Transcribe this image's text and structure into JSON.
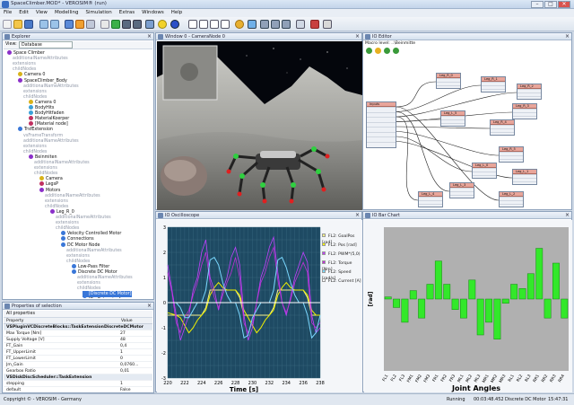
{
  "window": {
    "title": "SpaceClimber.MOD* - VEROSIM® (run)"
  },
  "menu": [
    "File",
    "Edit",
    "View",
    "Modelling",
    "Simulation",
    "Extras",
    "Windows",
    "Help"
  ],
  "explorer": {
    "title": "Explorer",
    "view_label": "View:",
    "view_value": "Database",
    "tree": [
      {
        "label": "Space Climber",
        "indent": 0,
        "color": "#8b2fc9"
      },
      {
        "label": "additionalNameAttributes",
        "indent": 1,
        "color": "",
        "faded": true
      },
      {
        "label": "extensions",
        "indent": 1,
        "color": "",
        "faded": true
      },
      {
        "label": "childNodes",
        "indent": 1,
        "color": "",
        "faded": true
      },
      {
        "label": "Camera 0",
        "indent": 2,
        "color": "#d8b21a"
      },
      {
        "label": "SpaceClimber_Body",
        "indent": 2,
        "color": "#8b2fc9"
      },
      {
        "label": "additionalNameAttributes",
        "indent": 3,
        "color": "",
        "faded": true
      },
      {
        "label": "extensions",
        "indent": 3,
        "color": "",
        "faded": true
      },
      {
        "label": "childNodes",
        "indent": 3,
        "color": "",
        "faded": true
      },
      {
        "label": "Camera 0",
        "indent": 4,
        "color": "#d8b21a"
      },
      {
        "label": "BodyHits",
        "indent": 4,
        "color": "#3aa0d8"
      },
      {
        "label": "BodyHitfaden",
        "indent": 4,
        "color": "#3aa0d8"
      },
      {
        "label": "MaterialKoerper",
        "indent": 4,
        "color": "#c03060"
      },
      {
        "label": "[Material node]",
        "indent": 4,
        "color": "#c03060"
      },
      {
        "label": "TrsfExtension",
        "indent": 2,
        "color": "#3a77d8"
      },
      {
        "label": "vsFrameTransform",
        "indent": 3,
        "color": "",
        "faded": true
      },
      {
        "label": "additionalNameAttributes",
        "indent": 3,
        "color": "",
        "faded": true
      },
      {
        "label": "extensions",
        "indent": 3,
        "color": "",
        "faded": true
      },
      {
        "label": "childNodes",
        "indent": 3,
        "color": "",
        "faded": true
      },
      {
        "label": "Beinmiten",
        "indent": 4,
        "color": "#8b2fc9"
      },
      {
        "label": "additionalNameAttributes",
        "indent": 5,
        "color": "",
        "faded": true
      },
      {
        "label": "extensions",
        "indent": 5,
        "color": "",
        "faded": true
      },
      {
        "label": "childNodes",
        "indent": 5,
        "color": "",
        "faded": true
      },
      {
        "label": "Camera",
        "indent": 6,
        "color": "#d8b21a"
      },
      {
        "label": "LegsP",
        "indent": 6,
        "color": "#c03060"
      },
      {
        "label": "Motors",
        "indent": 6,
        "color": "#8b2fc9"
      },
      {
        "label": "additionalNameAttributes",
        "indent": 7,
        "color": "",
        "faded": true
      },
      {
        "label": "extensions",
        "indent": 7,
        "color": "",
        "faded": true
      },
      {
        "label": "childNodes",
        "indent": 7,
        "color": "",
        "faded": true
      },
      {
        "label": "Leg_R_0",
        "indent": 8,
        "color": "#8b2fc9"
      },
      {
        "label": "additionalNameAttributes",
        "indent": 9,
        "color": "",
        "faded": true
      },
      {
        "label": "extensions",
        "indent": 9,
        "color": "",
        "faded": true
      },
      {
        "label": "childNodes",
        "indent": 9,
        "color": "",
        "faded": true
      },
      {
        "label": "Velocity Controlled Motor",
        "indent": 10,
        "color": "#3a77d8"
      },
      {
        "label": "Connections",
        "indent": 10,
        "color": "#3a77d8"
      },
      {
        "label": "DC Motor Node",
        "indent": 10,
        "color": "#3a77d8"
      },
      {
        "label": "additionalNameAttributes",
        "indent": 11,
        "color": "",
        "faded": true
      },
      {
        "label": "extensions",
        "indent": 11,
        "color": "",
        "faded": true
      },
      {
        "label": "childNodes",
        "indent": 11,
        "color": "",
        "faded": true
      },
      {
        "label": "Low-Pass Filter",
        "indent": 12,
        "color": "#3a77d8"
      },
      {
        "label": "Discrete DC Motor",
        "indent": 12,
        "color": "#3a77d8"
      },
      {
        "label": "additionalNameAttributes",
        "indent": 13,
        "color": "",
        "faded": true
      },
      {
        "label": "extensions",
        "indent": 13,
        "color": "",
        "faded": true
      },
      {
        "label": "childNodes",
        "indent": 13,
        "color": "",
        "faded": true
      },
      {
        "label": "[Discrete DC Motor]",
        "indent": 14,
        "color": "#3a77d8",
        "selected": true
      },
      {
        "label": "[PosExtension]",
        "indent": 14,
        "color": "#3a77d8"
      }
    ]
  },
  "properties": {
    "title": "Properties of selection",
    "filter": "All properties",
    "col_property": "Property",
    "col_value": "Value",
    "rows": [
      {
        "k": "VSPluginVCDiscreteBlocks::TaskExtensionDiscreteDCMotor",
        "v": "",
        "section": true
      },
      {
        "k": "Max Torque [Nm]",
        "v": "27"
      },
      {
        "k": "Supply Voltage [V]",
        "v": "48"
      },
      {
        "k": "FT_Gain",
        "v": "0,4"
      },
      {
        "k": "FT_UpperLimit",
        "v": "1"
      },
      {
        "k": "FT_LowerLimit",
        "v": "0"
      },
      {
        "k": "Jm_Gain",
        "v": "0,0760..."
      },
      {
        "k": "Gearbox Ratio",
        "v": "0,01"
      },
      {
        "k": "VSDiskDiscScheduler::TaskExtension",
        "v": "",
        "section": true
      },
      {
        "k": "stepping",
        "v": "1"
      },
      {
        "k": "default",
        "v": "False"
      }
    ]
  },
  "viewport": {
    "title": "Window 0 - CameraNode 0"
  },
  "ioeditor": {
    "title": "IO Editor",
    "macro_level": "Macro level: ..\\Beinmitte",
    "nodes": [
      "Leg_R_0",
      "Leg_R_1",
      "Leg_R_2",
      "Leg_R_3",
      "Leg_R_4",
      "Leg_R_5",
      "Leg_L_0",
      "Leg_L_1",
      "Leg_L_2",
      "Leg_L_3",
      "Leg_L_4",
      "Leg_L_5",
      "Inputs"
    ]
  },
  "oscope": {
    "title": "IO Oscilloscope",
    "legend": [
      {
        "label": "FL2: GoalPos [rad]",
        "color": "#f5f08a"
      },
      {
        "label": "FL2: Pos [rad]",
        "color": "#f2f200"
      },
      {
        "label": "FL2: PWM*(5,0)",
        "color": "#c040ff"
      },
      {
        "label": "FL2: Torque [Nm]",
        "color": "#c02fd8"
      },
      {
        "label": "FL2: Speed [rad/s]",
        "color": "#7ad8ff"
      },
      {
        "label": "FL2: Current [A]",
        "color": "#ffffff"
      }
    ],
    "xlabel": "Time [s]",
    "xticks": [
      "220",
      "222",
      "224",
      "226",
      "228",
      "230",
      "232",
      "234",
      "236",
      "238"
    ],
    "yticks": [
      "3",
      "2",
      "1",
      "0",
      "-1",
      "-2",
      "-3"
    ]
  },
  "barchart": {
    "title": "IO Bar Chart",
    "ylabel": "[rad]",
    "xlabel": "Joint Angles",
    "ticklabels": [
      "FL1",
      "FL2",
      "FL3",
      "FM1",
      "FM2",
      "FM3",
      "FR1",
      "FR2",
      "FR3",
      "ML1",
      "ML2",
      "ML3",
      "MR1",
      "MR2",
      "MR3",
      "RL1",
      "RL2",
      "RL3",
      "RR1",
      "RR2",
      "RR3",
      "RR4"
    ]
  },
  "status": {
    "copyright": "Copyright © - VEROSIM - Germany",
    "state": "Running",
    "time": "00:03:48.452",
    "selection": "Discrete DC Motor",
    "clock": "15:47:31"
  },
  "chart_data": [
    {
      "type": "line",
      "title": "",
      "xlabel": "Time [s]",
      "ylabel": "",
      "xlim": [
        220,
        238
      ],
      "ylim": [
        -3,
        3
      ],
      "grid": true,
      "legend": "right",
      "x": [
        220,
        220.5,
        221,
        221.5,
        222,
        222.5,
        223,
        223.5,
        224,
        224.5,
        225,
        225.5,
        226,
        226.5,
        227,
        227.5,
        228,
        228.5,
        229,
        229.5,
        230,
        230.5,
        231,
        231.5,
        232,
        232.5,
        233,
        233.5,
        234,
        234.5,
        235,
        235.5,
        236,
        236.5,
        237,
        237.5,
        238
      ],
      "series": [
        {
          "name": "FL2: GoalPos [rad]",
          "values": [
            -0.5,
            -0.5,
            -0.5,
            -0.5,
            -0.5,
            -0.5,
            -0.5,
            -0.5,
            -0.5,
            -0.2,
            0.5,
            0.5,
            0.5,
            0.5,
            0.5,
            0.5,
            0.5,
            0.2,
            -0.5,
            -0.5,
            -0.5,
            -0.5,
            -0.5,
            -0.5,
            -0.5,
            -0.2,
            0.5,
            0.5,
            0.5,
            0.5,
            0.5,
            0.5,
            0.5,
            0.2,
            -0.5,
            -0.5,
            -0.5
          ]
        },
        {
          "name": "FL2: Pos [rad]",
          "values": [
            -0.4,
            -0.45,
            -0.5,
            -0.6,
            -0.9,
            -1.2,
            -1.0,
            -0.7,
            -0.5,
            -0.3,
            0.3,
            0.6,
            0.8,
            0.6,
            0.5,
            0.5,
            0.5,
            0.3,
            -0.3,
            -0.6,
            -0.9,
            -1.2,
            -1.0,
            -0.7,
            -0.5,
            -0.3,
            0.3,
            0.6,
            0.8,
            0.6,
            0.5,
            0.5,
            0.5,
            0.3,
            -0.3,
            -0.5,
            -0.5
          ]
        },
        {
          "name": "FL2: PWM*(5,0)",
          "values": [
            1.5,
            0.5,
            -0.5,
            -1.5,
            -1.0,
            -0.5,
            0.5,
            1.0,
            2.0,
            2.5,
            1.0,
            0.5,
            -0.3,
            0.5,
            1.0,
            1.8,
            2.2,
            1.5,
            -0.5,
            -1.5,
            -1.0,
            0.0,
            1.0,
            1.5,
            2.2,
            2.6,
            1.2,
            0.0,
            -0.5,
            0.2,
            1.0,
            1.5,
            2.0,
            1.6,
            -0.5,
            -1.2,
            -1.0
          ]
        },
        {
          "name": "FL2: Torque [Nm]",
          "values": [
            1.2,
            0.4,
            -0.8,
            -1.2,
            -0.6,
            -0.3,
            0.3,
            0.8,
            1.5,
            2.0,
            0.8,
            0.2,
            -0.2,
            0.3,
            0.8,
            1.2,
            1.8,
            1.0,
            -0.8,
            -1.2,
            -0.8,
            0.0,
            0.8,
            1.2,
            1.8,
            2.2,
            0.9,
            0.0,
            -0.4,
            0.1,
            0.8,
            1.2,
            1.6,
            1.2,
            -0.8,
            -1.0,
            -0.8
          ]
        },
        {
          "name": "FL2: Speed [rad/s]",
          "values": [
            0.0,
            0.0,
            0.0,
            -0.2,
            -0.6,
            -0.6,
            -0.3,
            0.0,
            0.0,
            0.5,
            1.7,
            1.8,
            1.5,
            0.8,
            0.3,
            0.0,
            0.0,
            -0.5,
            -1.4,
            -1.3,
            -0.6,
            -0.3,
            0.0,
            0.0,
            0.0,
            0.5,
            1.7,
            1.8,
            1.4,
            0.8,
            0.3,
            0.0,
            0.0,
            -0.5,
            -1.4,
            -1.2,
            -0.5
          ]
        },
        {
          "name": "FL2: Current [A]",
          "values": [
            0.0,
            0.0,
            0.0,
            0.0,
            0.0,
            0.0,
            0.0,
            0.0,
            0.0,
            0.0,
            0.0,
            0.0,
            0.0,
            0.0,
            0.0,
            0.0,
            0.0,
            0.0,
            0.0,
            0.0,
            0.0,
            0.0,
            0.0,
            0.0,
            0.0,
            0.0,
            0.0,
            0.0,
            0.0,
            0.0,
            0.0,
            0.0,
            0.0,
            0.0,
            0.0,
            0.0,
            0.0
          ]
        }
      ]
    },
    {
      "type": "bar",
      "title": "",
      "xlabel": "Joint Angles",
      "ylabel": "[rad]",
      "ylim": [
        -1.7,
        1.7
      ],
      "categories": [
        "FL1",
        "FL2",
        "FL3",
        "FM1",
        "FM2",
        "FM3",
        "FR1",
        "FR2",
        "FR3",
        "ML1",
        "ML2",
        "ML3",
        "MR1",
        "MR2",
        "MR3",
        "RL1",
        "RL2",
        "RL3",
        "RR1",
        "RR2",
        "RR3",
        "RR4"
      ],
      "values": [
        0.05,
        -0.2,
        -0.55,
        0.2,
        -0.45,
        0.35,
        0.9,
        0.35,
        -0.25,
        -0.45,
        0.45,
        -0.85,
        -0.55,
        -0.95,
        -0.1,
        0.35,
        0.25,
        0.6,
        1.2,
        -0.45,
        0.85,
        -0.45
      ]
    }
  ]
}
